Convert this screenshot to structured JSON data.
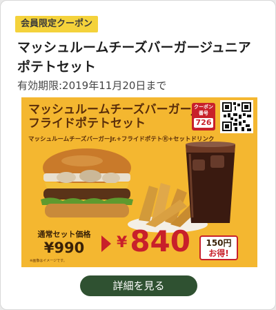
{
  "coupon": {
    "badge": "会員限定クーポン",
    "title": "マッシュルームチーズバーガージュニアポテトセット",
    "validity": "有効期限:2019年11月20日まで",
    "banner": {
      "title_line1": "マッシュルームチーズバーガーJr.",
      "title_line2": "フライドポテトセット",
      "subtitle": "マッシュルームチーズバーガーJr.+フライドポテトⓇ+セットドリンク",
      "coupon_label": "クーポン番号",
      "coupon_number": "726",
      "normal_price_label": "通常セット価格",
      "normal_price": "¥990",
      "yen_symbol": "¥",
      "price": "840",
      "savings_amount": "150円",
      "savings_word": "お得!",
      "note": "※画像はイメージです。"
    },
    "detail_button": "詳細を見る"
  },
  "colors": {
    "badge": "#f4d23b",
    "banner_background": "#f4b730",
    "accent_red": "#c8202a",
    "button": "#2f5131"
  }
}
